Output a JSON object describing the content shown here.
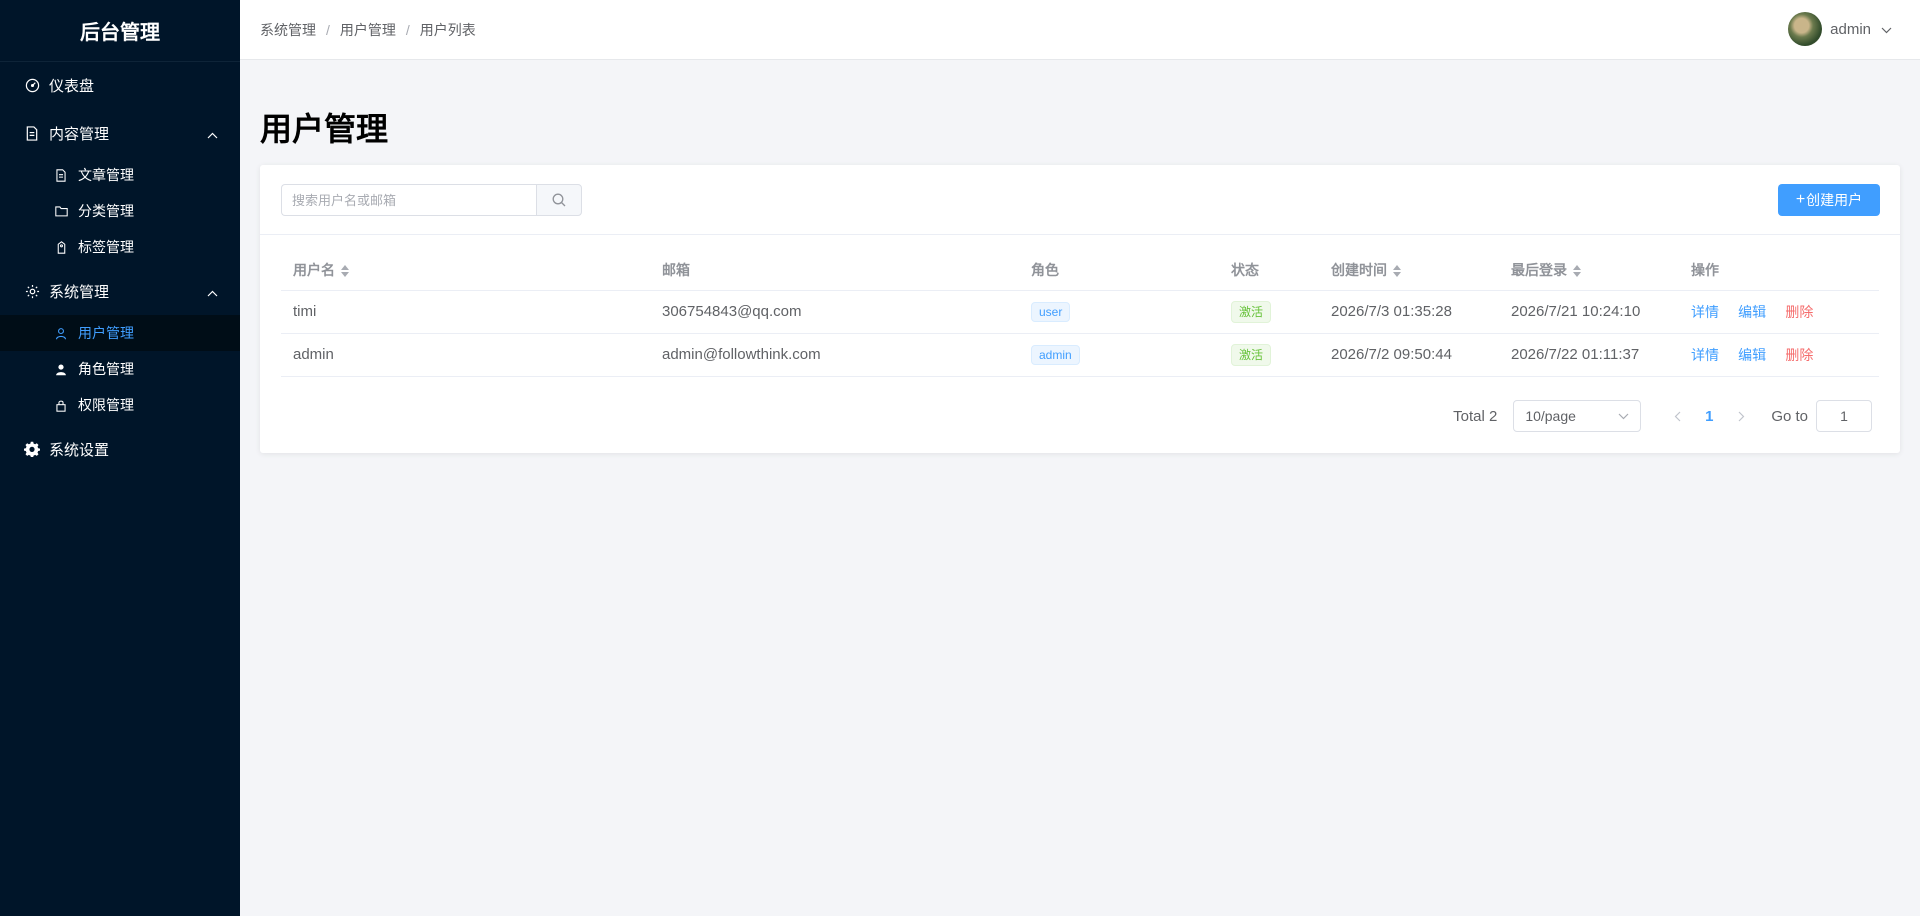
{
  "app": {
    "title": "后台管理"
  },
  "sidebar": {
    "dashboard": "仪表盘",
    "content_group": {
      "label": "内容管理",
      "items": [
        "文章管理",
        "分类管理",
        "标签管理"
      ]
    },
    "system_group": {
      "label": "系统管理",
      "items": [
        "用户管理",
        "角色管理",
        "权限管理"
      ],
      "active": "用户管理"
    },
    "settings": "系统设置"
  },
  "header": {
    "breadcrumb": [
      "系统管理",
      "用户管理",
      "用户列表"
    ],
    "separator": "/",
    "username": "admin"
  },
  "page": {
    "title": "用户管理"
  },
  "toolbar": {
    "search_placeholder": "搜索用户名或邮箱",
    "create_label": "创建用户",
    "create_icon": "+"
  },
  "table": {
    "columns": [
      "用户名",
      "邮箱",
      "角色",
      "状态",
      "创建时间",
      "最后登录",
      "操作"
    ],
    "rows": [
      {
        "username": "timi",
        "email": "306754843@qq.com",
        "role": "user",
        "status": "激活",
        "created": "2026/7/3 01:35:28",
        "last_login": "2026/7/21 10:24:10"
      },
      {
        "username": "admin",
        "email": "admin@followthink.com",
        "role": "admin",
        "status": "激活",
        "created": "2026/7/2 09:50:44",
        "last_login": "2026/7/22 01:11:37"
      }
    ],
    "actions": {
      "detail": "详情",
      "edit": "编辑",
      "delete": "删除"
    }
  },
  "pagination": {
    "total": "Total 2",
    "page_size": "10/page",
    "current_page": "1",
    "goto_label": "Go to",
    "goto_value": "1"
  },
  "colors": {
    "sidebar_bg": "#001529",
    "accent": "#409eff",
    "danger": "#f56c6c",
    "success": "#67c23a"
  }
}
